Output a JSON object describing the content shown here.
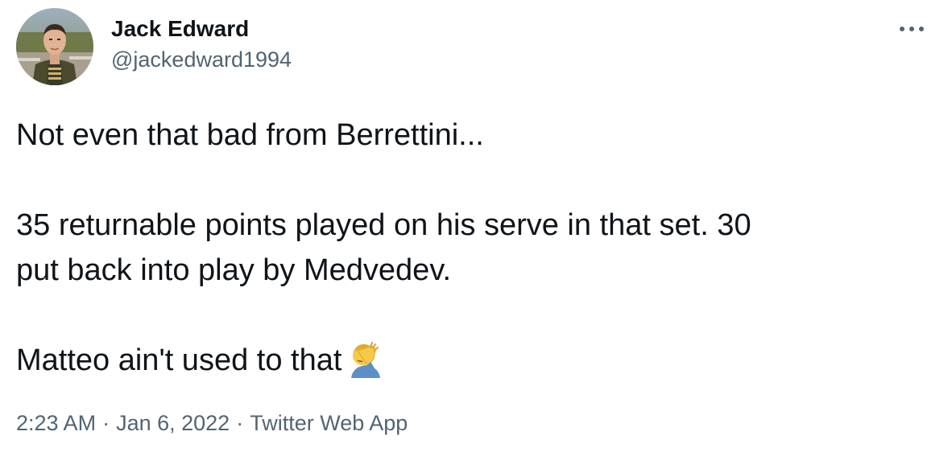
{
  "author": {
    "display_name": "Jack Edward",
    "handle": "@jackedward1994"
  },
  "menu": {
    "icon": "more-horizontal-icon"
  },
  "tweet": {
    "line1": "Not even that bad from Berrettini...",
    "line2": "35 returnable points played on his serve in that set. 30",
    "line3": "put back into play by Medvedev.",
    "line4": "Matteo ain't used to that",
    "emoji": "person-facepalming-emoji"
  },
  "meta": {
    "time": "2:23 AM",
    "separator": "·",
    "date": "Jan 6, 2022",
    "source": "Twitter Web App"
  },
  "colors": {
    "text": "#0f1419",
    "secondary": "#536471",
    "background": "#ffffff"
  }
}
